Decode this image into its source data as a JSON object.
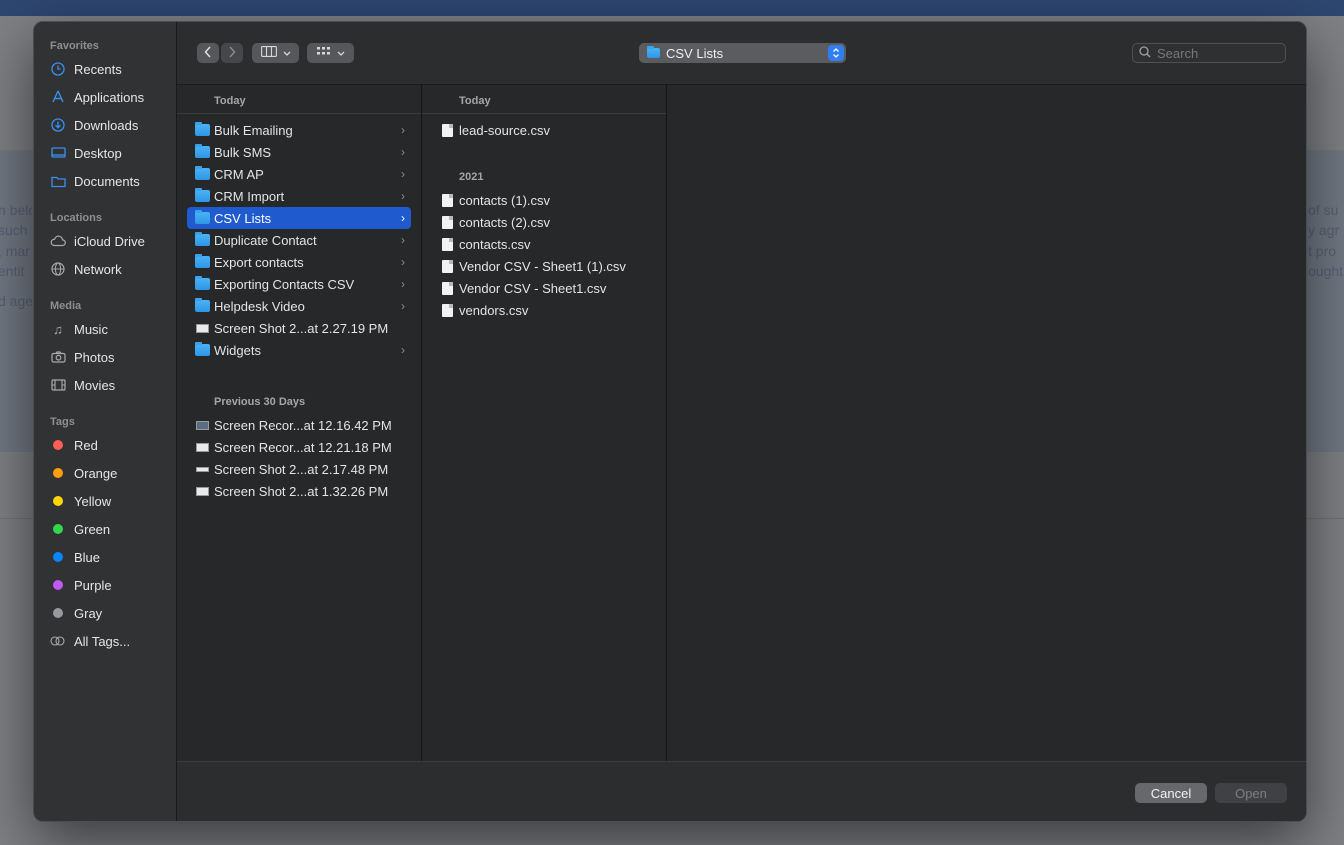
{
  "background": {
    "left_text": [
      "n belo",
      "such",
      ", mar",
      "entit",
      "d age"
    ],
    "right_text": [
      "of su",
      "y agr",
      "t pro",
      "ought"
    ]
  },
  "sidebar": {
    "favorites_title": "Favorites",
    "favorites": [
      {
        "label": "Recents",
        "icon": "clock-icon"
      },
      {
        "label": "Applications",
        "icon": "applications-icon"
      },
      {
        "label": "Downloads",
        "icon": "downloads-icon"
      },
      {
        "label": "Desktop",
        "icon": "desktop-icon"
      },
      {
        "label": "Documents",
        "icon": "folder-icon"
      }
    ],
    "locations_title": "Locations",
    "locations": [
      {
        "label": "iCloud Drive",
        "icon": "cloud-icon"
      },
      {
        "label": "Network",
        "icon": "globe-icon"
      }
    ],
    "media_title": "Media",
    "media": [
      {
        "label": "Music",
        "icon": "music-icon"
      },
      {
        "label": "Photos",
        "icon": "camera-icon"
      },
      {
        "label": "Movies",
        "icon": "film-icon"
      }
    ],
    "tags_title": "Tags",
    "tags": [
      {
        "label": "Red",
        "color": "#ff5f57"
      },
      {
        "label": "Orange",
        "color": "#ff9f0a"
      },
      {
        "label": "Yellow",
        "color": "#ffd60a"
      },
      {
        "label": "Green",
        "color": "#32d74b"
      },
      {
        "label": "Blue",
        "color": "#0a84ff"
      },
      {
        "label": "Purple",
        "color": "#bf5af2"
      },
      {
        "label": "Gray",
        "color": "#98989d"
      }
    ],
    "all_tags": "All Tags..."
  },
  "toolbar": {
    "back_icon": "chevron-left-icon",
    "forward_icon": "chevron-right-icon",
    "view_icon": "columns-view-icon",
    "group_icon": "grid-group-icon",
    "path_label": "CSV Lists",
    "search_placeholder": "Search"
  },
  "column1": {
    "header": "Today",
    "items": [
      {
        "label": "Bulk Emailing",
        "type": "folder"
      },
      {
        "label": "Bulk SMS",
        "type": "folder"
      },
      {
        "label": "CRM AP",
        "type": "folder"
      },
      {
        "label": "CRM Import",
        "type": "folder"
      },
      {
        "label": "CSV Lists",
        "type": "folder",
        "selected": true
      },
      {
        "label": "Duplicate Contact",
        "type": "folder"
      },
      {
        "label": "Export contacts",
        "type": "folder"
      },
      {
        "label": "Exporting Contacts CSV",
        "type": "folder"
      },
      {
        "label": "Helpdesk Video",
        "type": "folder"
      },
      {
        "label": "Screen Shot 2...at 2.27.19 PM",
        "type": "image"
      },
      {
        "label": "Widgets",
        "type": "folder"
      }
    ],
    "group2_header": "Previous 30 Days",
    "group2_items": [
      {
        "label": "Screen Recor...at 12.16.42 PM",
        "type": "video"
      },
      {
        "label": "Screen Recor...at 12.21.18 PM",
        "type": "video"
      },
      {
        "label": "Screen Shot 2...at 2.17.48 PM",
        "type": "image"
      },
      {
        "label": "Screen Shot 2...at 1.32.26 PM",
        "type": "image"
      }
    ]
  },
  "column2": {
    "header": "Today",
    "items": [
      {
        "label": "lead-source.csv"
      }
    ],
    "group2_header": "2021",
    "group2_items": [
      {
        "label": "contacts (1).csv"
      },
      {
        "label": "contacts (2).csv"
      },
      {
        "label": "contacts.csv"
      },
      {
        "label": "Vendor CSV - Sheet1 (1).csv"
      },
      {
        "label": "Vendor CSV - Sheet1.csv"
      },
      {
        "label": "vendors.csv"
      }
    ]
  },
  "footer": {
    "cancel_label": "Cancel",
    "open_label": "Open"
  }
}
